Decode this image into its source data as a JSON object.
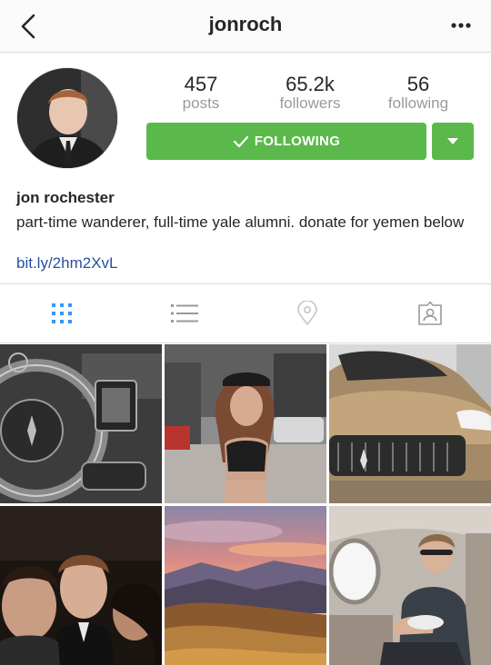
{
  "header": {
    "username": "jonroch"
  },
  "stats": [
    {
      "value": "457",
      "label": "posts"
    },
    {
      "value": "65.2k",
      "label": "followers"
    },
    {
      "value": "56",
      "label": "following"
    }
  ],
  "follow_button": {
    "label": "FOLLOWING"
  },
  "profile": {
    "name": "jon rochester",
    "bio": "part-time wanderer, full-time yale alumni. donate for yemen below",
    "link": "bit.ly/2hm2XvL"
  },
  "tabs": [
    {
      "icon": "grid-icon",
      "active": true
    },
    {
      "icon": "list-icon",
      "active": false
    },
    {
      "icon": "location-pin-icon",
      "active": false
    },
    {
      "icon": "tagged-icon",
      "active": false
    }
  ],
  "colors": {
    "accent_green": "#5ab94a",
    "link_blue": "#2a4fa5",
    "active_tab_blue": "#3897f0",
    "muted_gray": "#9a9a9a"
  },
  "posts": [
    {
      "subject": "car steering wheel interior"
    },
    {
      "subject": "woman in cap on street"
    },
    {
      "subject": "gold sports car"
    },
    {
      "subject": "group selfie"
    },
    {
      "subject": "mountain sunset"
    },
    {
      "subject": "man in private jet"
    }
  ]
}
